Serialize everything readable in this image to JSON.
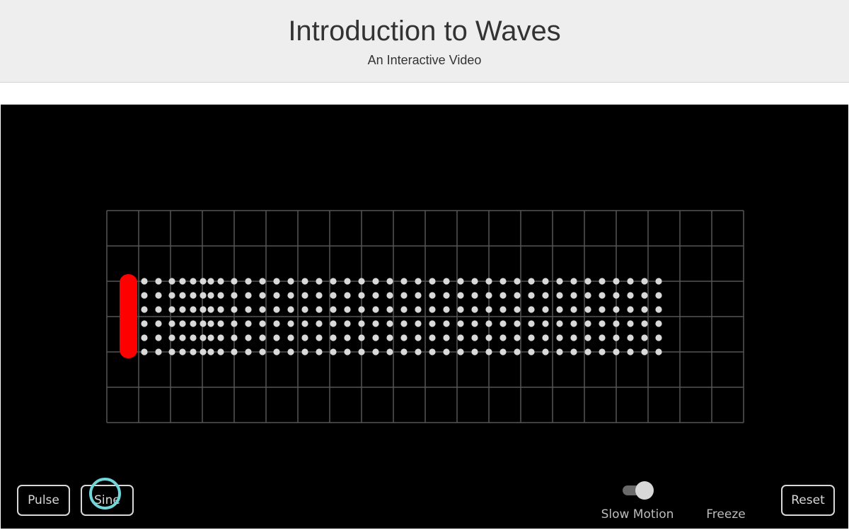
{
  "header": {
    "title": "Introduction to Waves",
    "subtitle": "An Interactive Video"
  },
  "stage": {
    "background": "#000000",
    "grid_color": "#555555",
    "particle_color": "#d9d9d9",
    "oscillator_color": "#ff0000",
    "particle_columns": 39,
    "particle_rows": 6
  },
  "controls": {
    "pulse_label": "Pulse",
    "sine_label": "Sine",
    "slow_motion_label": "Slow Motion",
    "slow_motion_on": true,
    "freeze_label": "Freeze",
    "reset_label": "Reset"
  },
  "cursor": {
    "color": "#6fd6dc"
  }
}
